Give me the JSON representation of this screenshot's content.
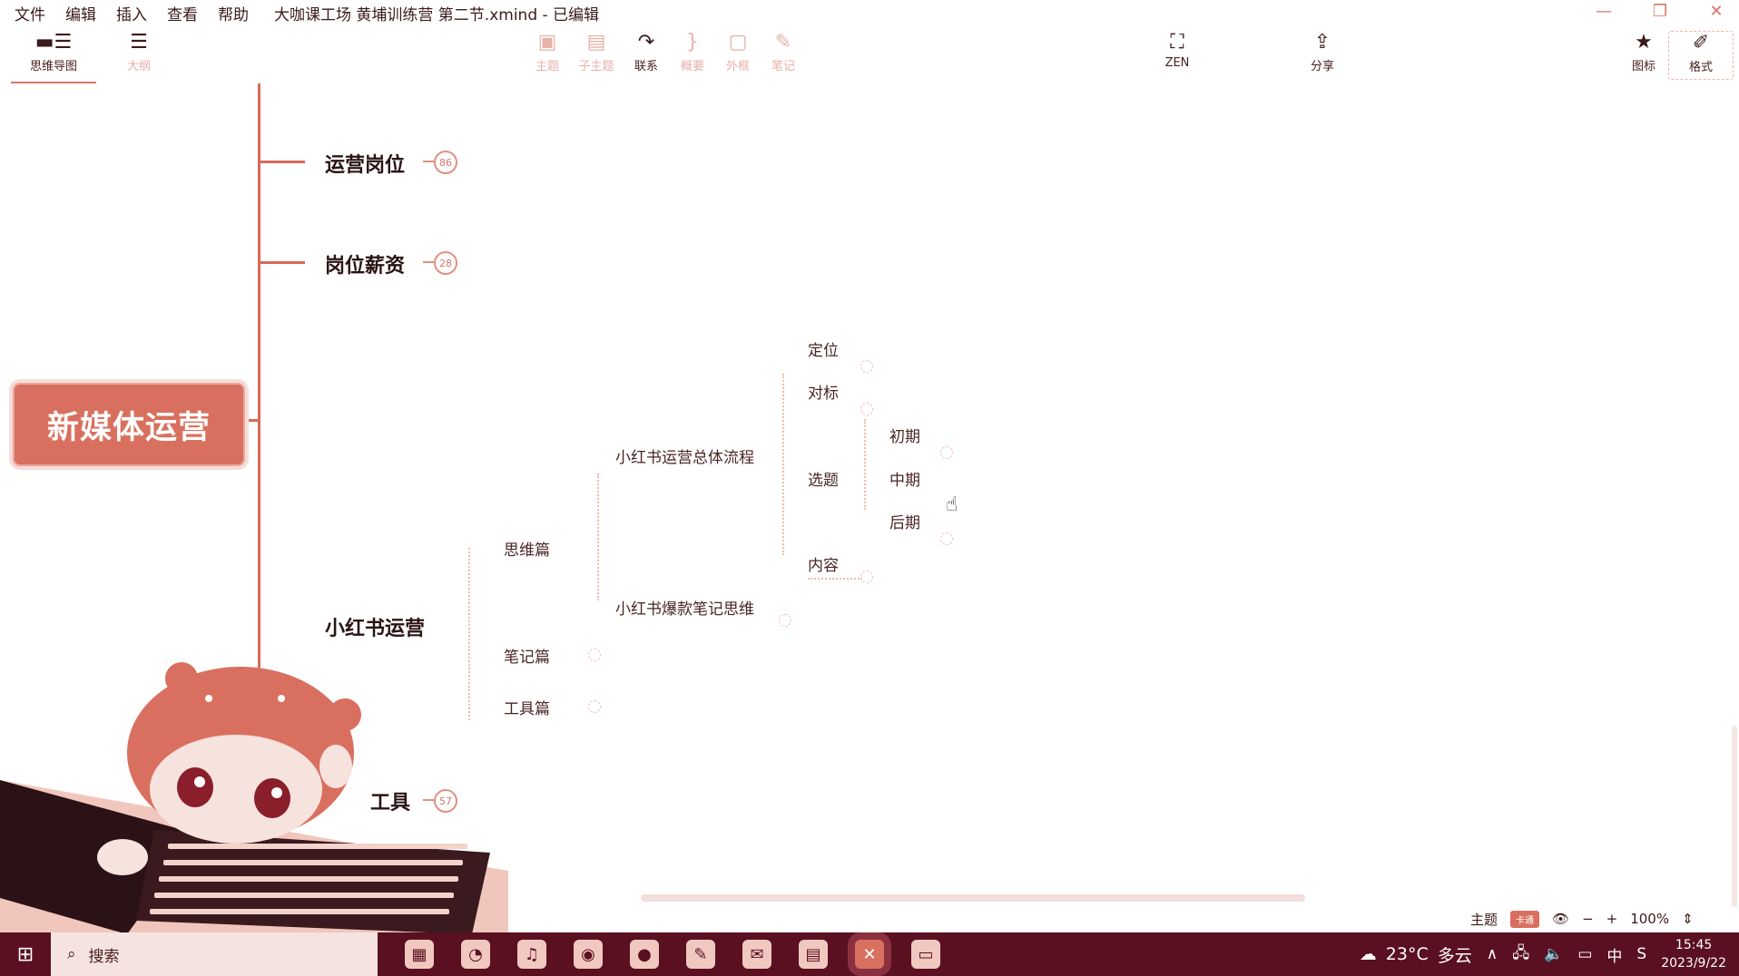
{
  "menu": {
    "items": [
      "文件",
      "编辑",
      "插入",
      "查看",
      "帮助"
    ],
    "title": "大咖课工场 黄埔训练营 第二节.xmind - 已编辑"
  },
  "toolbar": {
    "mindmap_label": "思维导图",
    "outline_label": "大纲",
    "topic_label": "主题",
    "subtopic_label": "子主题",
    "relationship_label": "联系",
    "summary_label": "概要",
    "boundary_label": "外框",
    "note_label": "笔记",
    "zen_label": "ZEN",
    "share_label": "分享",
    "icon_label": "图标",
    "format_label": "格式"
  },
  "map": {
    "root": "新媒体运营",
    "main_topics": [
      {
        "label": "运营岗位",
        "count": "86"
      },
      {
        "label": "岗位薪资",
        "count": "28"
      },
      {
        "label": "小红书运营",
        "count": ""
      },
      {
        "label": "工具",
        "count": "57"
      }
    ],
    "xhs_children": [
      "思维篇",
      "笔记篇",
      "工具篇"
    ],
    "thinking_children": [
      "小红书运营总体流程",
      "小红书爆款笔记思维"
    ],
    "flow_children": [
      "定位",
      "对标",
      "选题",
      "内容"
    ],
    "topic_stages": [
      "初期",
      "中期",
      "后期"
    ]
  },
  "status": {
    "theme_label": "主题",
    "theme_tag": "卡通",
    "zoom": "100%"
  },
  "taskbar": {
    "search_placeholder": "搜索",
    "weather_temp": "23°C",
    "weather_text": "多云",
    "ime": "中",
    "time": "15:45",
    "date": "2023/9/22"
  },
  "colors": {
    "accent": "#d9705f",
    "taskbar": "#5a1020"
  }
}
